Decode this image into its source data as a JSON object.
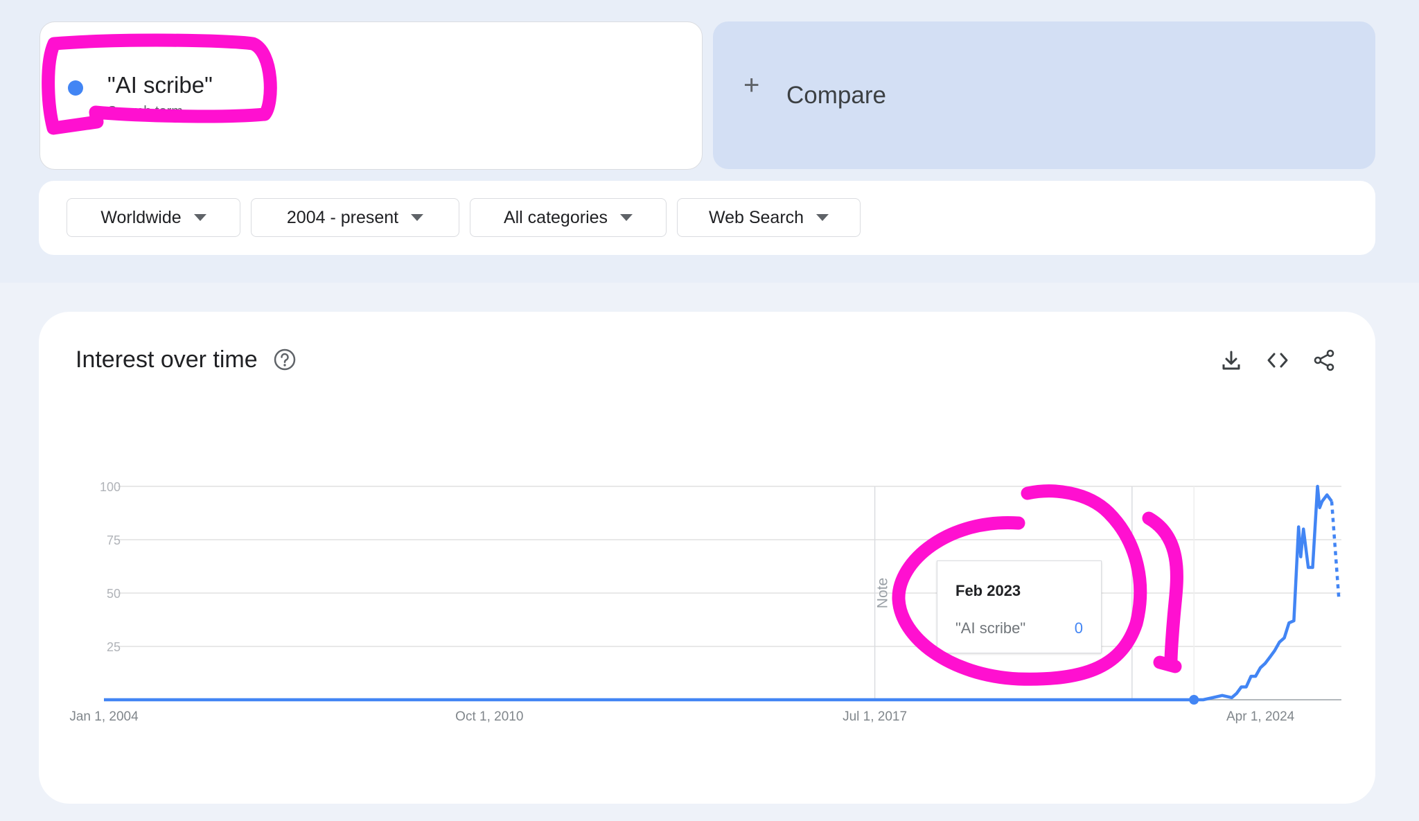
{
  "search_term": {
    "label": "\"AI scribe\"",
    "subtitle": "Search term",
    "color": "#4285f4"
  },
  "compare": {
    "label": "Compare",
    "icon": "plus-icon"
  },
  "filters": [
    {
      "label": "Worldwide"
    },
    {
      "label": "2004 - present"
    },
    {
      "label": "All categories"
    },
    {
      "label": "Web Search"
    }
  ],
  "section": {
    "title": "Interest over time",
    "icons": [
      "help-icon",
      "download-icon",
      "embed-code-icon",
      "share-icon"
    ]
  },
  "tooltip": {
    "date": "Feb 2023",
    "series": "\"AI scribe\"",
    "value": "0"
  },
  "annotation_color": "#ff10d0",
  "chart_data": {
    "type": "line",
    "title": "",
    "xlabel": "",
    "ylabel": "",
    "ylim": [
      0,
      100
    ],
    "yticks": [
      100,
      75,
      50,
      25
    ],
    "x_tick_labels": [
      "Jan 1, 2004",
      "Oct 1, 2010",
      "Jul 1, 2017",
      "Apr 1, 2024"
    ],
    "x_tick_dates": [
      "2004-01-01",
      "2010-10-01",
      "2017-07-01",
      "2024-04-01"
    ],
    "notes": [
      {
        "label": "Note",
        "date": "2017-07-01"
      },
      {
        "label": "Note",
        "date": "2022-01-01"
      }
    ],
    "highlight": {
      "date": "2023-02-01",
      "value": 0
    },
    "grid": true,
    "legend": "none",
    "series": [
      {
        "color": "#4285f4",
        "points": [
          [
            "2004-01-01",
            0
          ],
          [
            "2023-02-01",
            0
          ],
          [
            "2023-04-01",
            0
          ],
          [
            "2023-06-01",
            1
          ],
          [
            "2023-08-01",
            2
          ],
          [
            "2023-10-01",
            1
          ],
          [
            "2023-11-01",
            3
          ],
          [
            "2023-12-01",
            6
          ],
          [
            "2024-01-01",
            6
          ],
          [
            "2024-02-01",
            11
          ],
          [
            "2024-03-01",
            11
          ],
          [
            "2024-04-01",
            15
          ],
          [
            "2024-05-01",
            17
          ],
          [
            "2024-06-01",
            20
          ],
          [
            "2024-07-01",
            23
          ],
          [
            "2024-08-01",
            27
          ],
          [
            "2024-09-01",
            29
          ],
          [
            "2024-10-01",
            36
          ],
          [
            "2024-11-01",
            37
          ],
          [
            "2024-12-01",
            81
          ],
          [
            "2024-12-15",
            67
          ],
          [
            "2025-01-01",
            80
          ],
          [
            "2025-02-01",
            62
          ],
          [
            "2025-03-01",
            62
          ],
          [
            "2025-04-01",
            100
          ],
          [
            "2025-04-15",
            90
          ],
          [
            "2025-05-01",
            93
          ],
          [
            "2025-06-01",
            96
          ],
          [
            "2025-07-01",
            93
          ]
        ],
        "partial": [
          [
            "2025-07-01",
            93
          ],
          [
            "2025-08-15",
            48
          ]
        ]
      }
    ]
  }
}
